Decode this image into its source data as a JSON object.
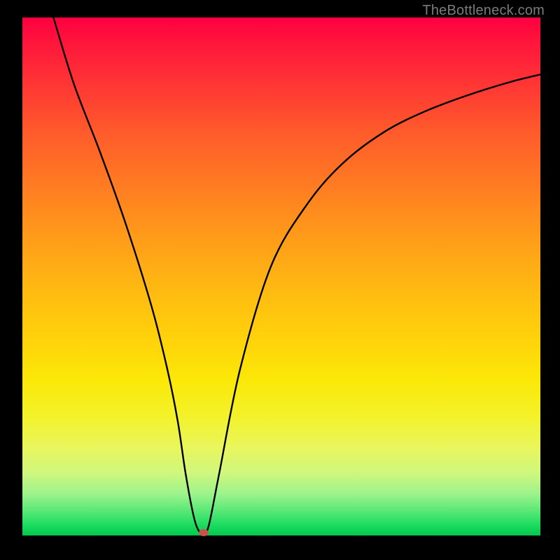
{
  "watermark": "TheBottleneck.com",
  "chart_data": {
    "type": "line",
    "title": "",
    "xlabel": "",
    "ylabel": "",
    "xlim": [
      0,
      100
    ],
    "ylim": [
      0,
      100
    ],
    "grid": false,
    "legend": false,
    "series": [
      {
        "name": "curve",
        "x": [
          6,
          10,
          15,
          20,
          25,
          28,
          30,
          31.5,
          33,
          34,
          35,
          36,
          38,
          42,
          48,
          55,
          62,
          70,
          78,
          86,
          94,
          100
        ],
        "y": [
          100,
          87,
          74,
          60,
          44,
          32,
          22,
          12,
          4,
          1,
          0.5,
          2,
          12,
          32,
          52,
          64,
          72,
          78,
          82,
          85,
          87.5,
          89
        ]
      }
    ],
    "marker": {
      "x": 35,
      "y": 0.5
    }
  },
  "colors": {
    "curve": "#000000",
    "dot": "#c9524b",
    "background_top": "#ff0040",
    "background_bottom": "#00c94e",
    "frame": "#000000",
    "watermark": "#7b7b7b"
  }
}
